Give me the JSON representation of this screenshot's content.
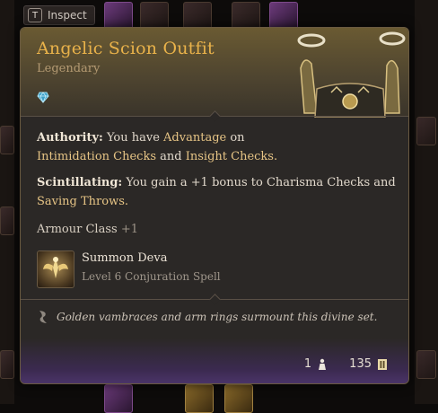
{
  "inspect": {
    "key": "T",
    "label": "Inspect"
  },
  "item": {
    "name": "Angelic Scion Outfit",
    "rarity": "Legendary",
    "colors": {
      "title": "#e9b24a",
      "highlight": "#e6c485",
      "footer": "#4a3468"
    }
  },
  "properties": {
    "authority": {
      "name": "Authority:",
      "pre": "You have",
      "advantage": "Advantage",
      "mid": "on",
      "checks": "Intimidation Checks",
      "and": "and",
      "checks2": "Insight Checks."
    },
    "scintillating": {
      "name": "Scintillating:",
      "text": "You gain a +1 bonus to Charisma Checks and",
      "throws": "Saving Throws."
    },
    "armour_class": {
      "label": "Armour Class",
      "value": "+1"
    }
  },
  "spell": {
    "name": "Summon Deva",
    "subtitle": "Level 6 Conjuration Spell"
  },
  "flavor": "Golden vambraces and arm rings surmount this divine set.",
  "footer": {
    "weight": "1",
    "value": "135"
  },
  "icons": [
    "gem-icon",
    "item-art-icon",
    "spell-icon",
    "quill-icon",
    "weight-icon",
    "coin-icon"
  ]
}
